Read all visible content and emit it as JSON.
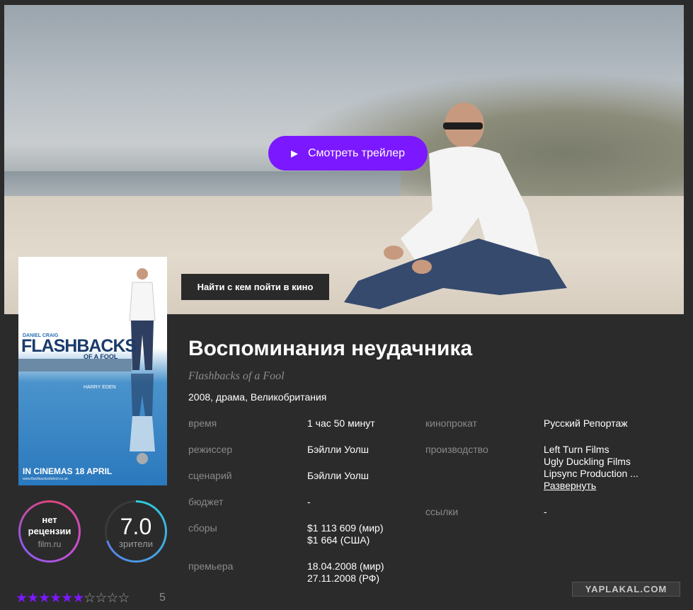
{
  "hero": {
    "trailer_label": "Смотреть трейлер",
    "find_label": "Найти с кем пойти в кино"
  },
  "poster": {
    "actor1": "DANIEL CRAIG",
    "title": "FLASHBACKS",
    "subtitle": "OF A FOOL",
    "actor2": "HARRY EDEN",
    "cinema_line": "IN CINEMAS 18 APRIL",
    "url": "www.flashbacksofafool.co.uk"
  },
  "film": {
    "title": "Воспоминания неудачника",
    "original_title": "Flashbacks of a Fool",
    "meta": "2008, драма, Великобритания"
  },
  "details_left": [
    {
      "label": "время",
      "value": [
        "1 час 50 минут"
      ]
    },
    {
      "label": "режиссер",
      "value": [
        "Бэйлли Уолш"
      ]
    },
    {
      "label": "сценарий",
      "value": [
        "Бэйлли Уолш"
      ]
    },
    {
      "label": "бюджет",
      "value": [
        "-"
      ]
    },
    {
      "label": "сборы",
      "value": [
        "$1 113 609 (мир)",
        "$1 664 (США)"
      ]
    },
    {
      "label": "премьера",
      "value": [
        "18.04.2008 (мир)",
        "27.11.2008 (РФ)"
      ]
    }
  ],
  "details_right": {
    "distribution_label": "кинопрокат",
    "distribution_value": "Русский Репортаж",
    "production_label": "производство",
    "production_values": [
      "Left Turn Films",
      "Ugly Duckling Films",
      "Lipsync Production ..."
    ],
    "expand_label": "Развернуть",
    "links_label": "ссылки",
    "links_value": "-"
  },
  "rating_filmru": {
    "line1": "нет",
    "line2": "рецензии",
    "source": "film.ru"
  },
  "rating_viewers": {
    "score": "7.0",
    "label": "зрители",
    "score_value": 7.0
  },
  "stars": {
    "filled": 6,
    "total": 10,
    "count": "5"
  },
  "watermark": "YAPLAKAL.COM",
  "colors": {
    "accent": "#7b18ff",
    "background": "#2b2b2b",
    "label_gray": "#8a8a8a"
  }
}
